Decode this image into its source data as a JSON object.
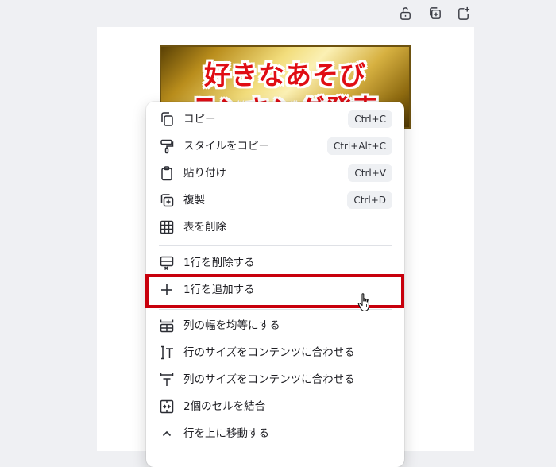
{
  "banner": {
    "line1": "好きなあそび",
    "line2": "ランキング発表"
  },
  "top_toolbar": {
    "icons": [
      "unlock-icon",
      "duplicate-page-icon",
      "add-page-icon"
    ]
  },
  "context_menu": {
    "items": [
      {
        "label": "コピー",
        "shortcut": "Ctrl+C",
        "icon": "copy-icon"
      },
      {
        "label": "スタイルをコピー",
        "shortcut": "Ctrl+Alt+C",
        "icon": "paint-roller-icon"
      },
      {
        "label": "貼り付け",
        "shortcut": "Ctrl+V",
        "icon": "clipboard-icon"
      },
      {
        "label": "複製",
        "shortcut": "Ctrl+D",
        "icon": "duplicate-icon"
      },
      {
        "label": "表を削除",
        "shortcut": "",
        "icon": "table-grid-icon"
      },
      {
        "label": "1行を削除する",
        "shortcut": "",
        "icon": "delete-row-icon"
      },
      {
        "label": "1行を追加する",
        "shortcut": "",
        "icon": "plus-icon"
      },
      {
        "label": "列の幅を均等にする",
        "shortcut": "",
        "icon": "equal-columns-icon"
      },
      {
        "label": "行のサイズをコンテンツに合わせる",
        "shortcut": "",
        "icon": "fit-row-icon"
      },
      {
        "label": "列のサイズをコンテンツに合わせる",
        "shortcut": "",
        "icon": "fit-column-icon"
      },
      {
        "label": "2個のセルを結合",
        "shortcut": "",
        "icon": "merge-cells-icon"
      },
      {
        "label": "行を上に移動する",
        "shortcut": "",
        "icon": "chevron-up-icon"
      }
    ],
    "highlighted_item": "1行を追加する"
  },
  "colors": {
    "highlight_border": "#c8000c",
    "banner_text": "#e00d14",
    "background": "#eff0f3"
  }
}
